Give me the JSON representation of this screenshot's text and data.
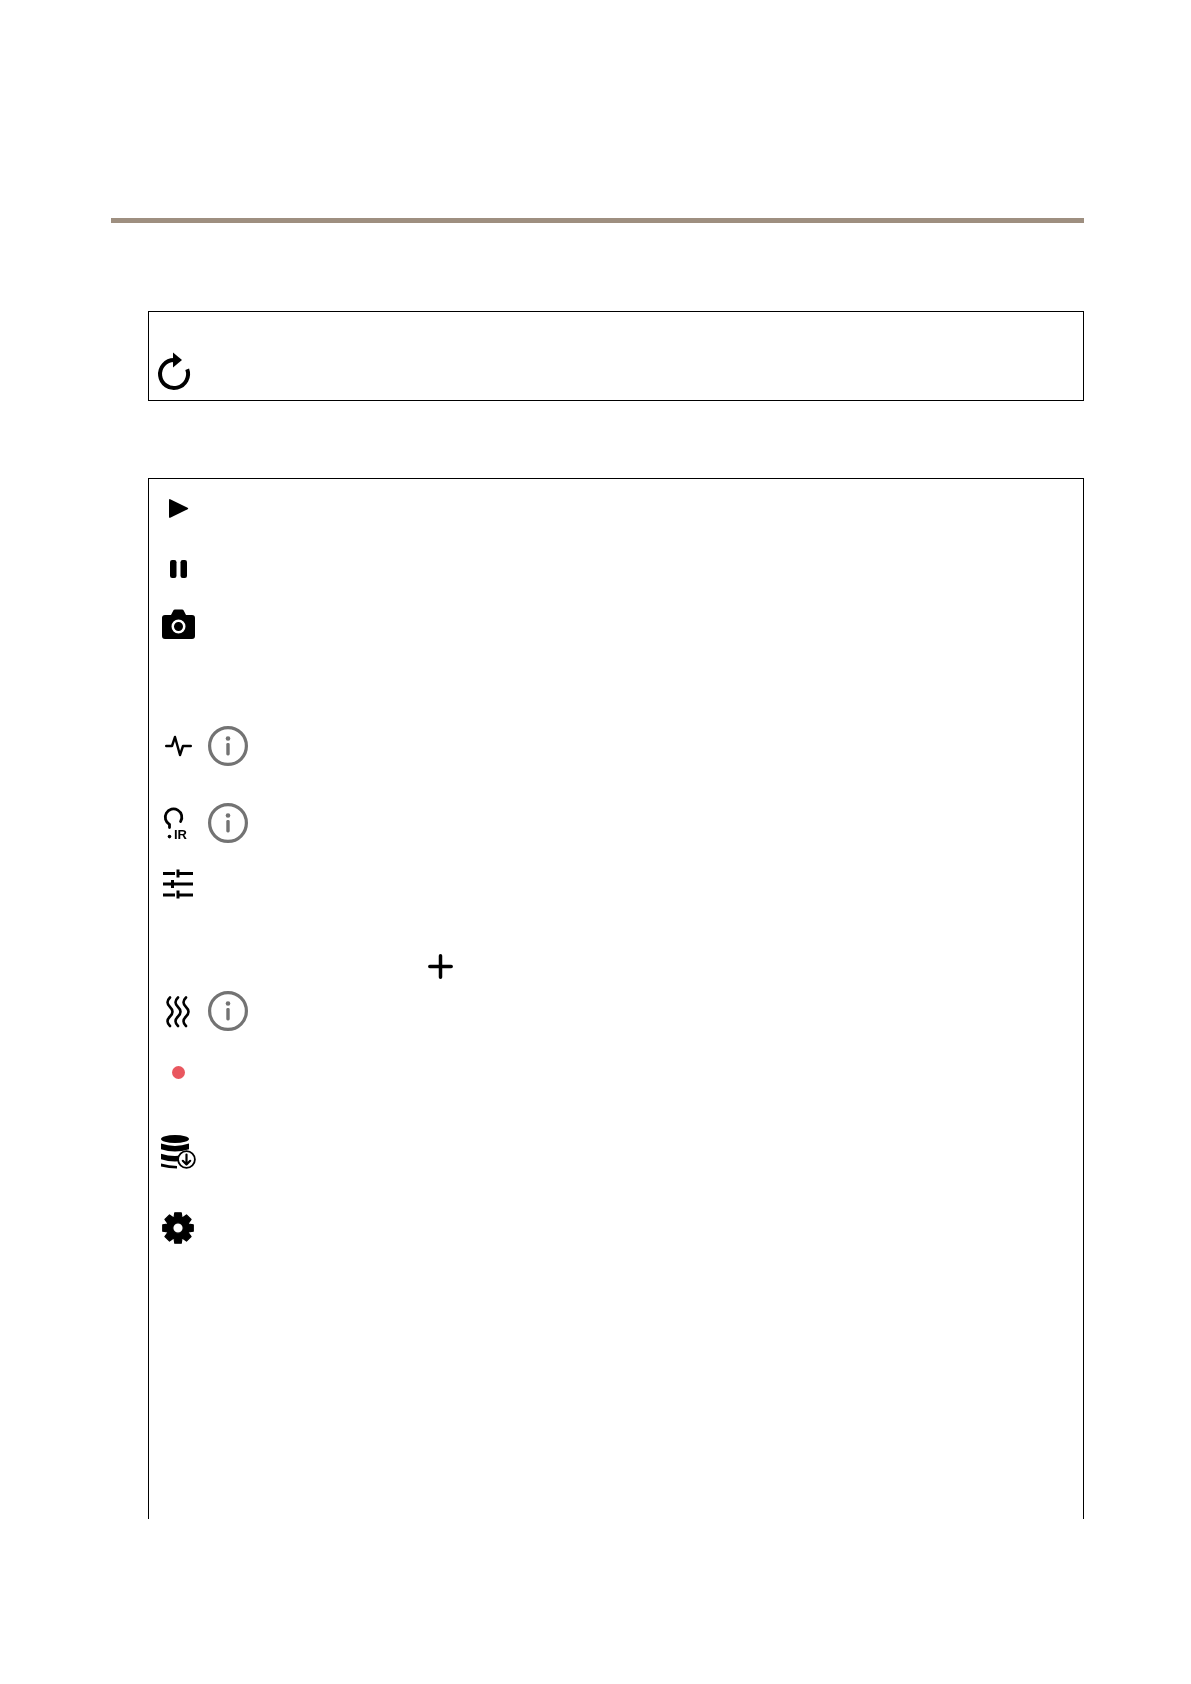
{
  "top_panel": {
    "icons": [
      {
        "kind": "refresh"
      }
    ]
  },
  "main_panel": {
    "rows": [
      {
        "icons": [
          {
            "kind": "play"
          }
        ]
      },
      {
        "icons": [
          {
            "kind": "pause"
          }
        ]
      },
      {
        "icons": [
          {
            "kind": "camera"
          }
        ]
      },
      {
        "icons": [
          {
            "kind": "pulse"
          },
          {
            "kind": "info"
          }
        ]
      },
      {
        "icons": [
          {
            "kind": "ir-lamp",
            "label": "IR"
          },
          {
            "kind": "info"
          }
        ]
      },
      {
        "icons": [
          {
            "kind": "sliders"
          }
        ]
      },
      {
        "icons": [
          {
            "kind": "plus"
          }
        ]
      },
      {
        "icons": [
          {
            "kind": "heat"
          },
          {
            "kind": "info"
          }
        ]
      },
      {
        "icons": [
          {
            "kind": "dot",
            "color": "#e9575f"
          }
        ]
      },
      {
        "icons": [
          {
            "kind": "database-download"
          }
        ]
      },
      {
        "icons": [
          {
            "kind": "gear"
          }
        ]
      }
    ]
  }
}
